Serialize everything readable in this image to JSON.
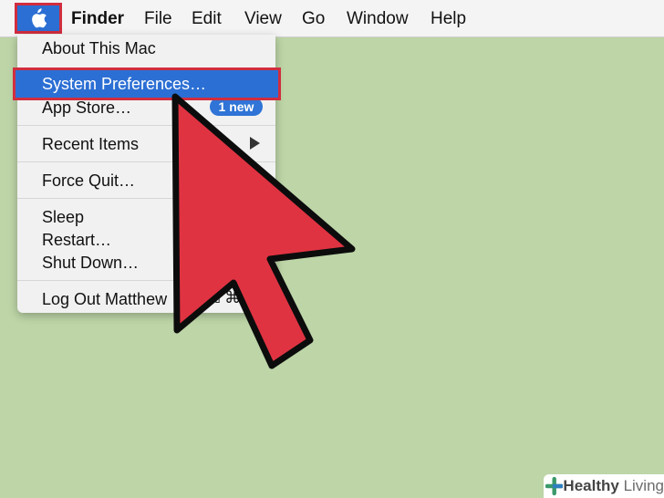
{
  "menubar": {
    "apple_icon": "apple-logo-icon",
    "items": [
      {
        "label": "Finder"
      },
      {
        "label": "File"
      },
      {
        "label": "Edit"
      },
      {
        "label": "View"
      },
      {
        "label": "Go"
      },
      {
        "label": "Window"
      },
      {
        "label": "Help"
      }
    ]
  },
  "apple_menu": {
    "about": "About This Mac",
    "system_preferences": "System Preferences…",
    "app_store": "App Store…",
    "app_store_badge": "1 new",
    "recent_items": "Recent Items",
    "force_quit": "Force Quit…",
    "sleep": "Sleep",
    "restart": "Restart…",
    "shut_down": "Shut Down…",
    "log_out": "Log Out Matthew",
    "log_out_shortcut": "⇧⌘Q"
  },
  "watermark": {
    "part1": "Healthy",
    "part2": "Living"
  },
  "colors": {
    "desktop": "#bdd5a7",
    "highlight": "#2c6fd4",
    "annotation_red": "#d12d3e",
    "cursor_red": "#e03342"
  }
}
